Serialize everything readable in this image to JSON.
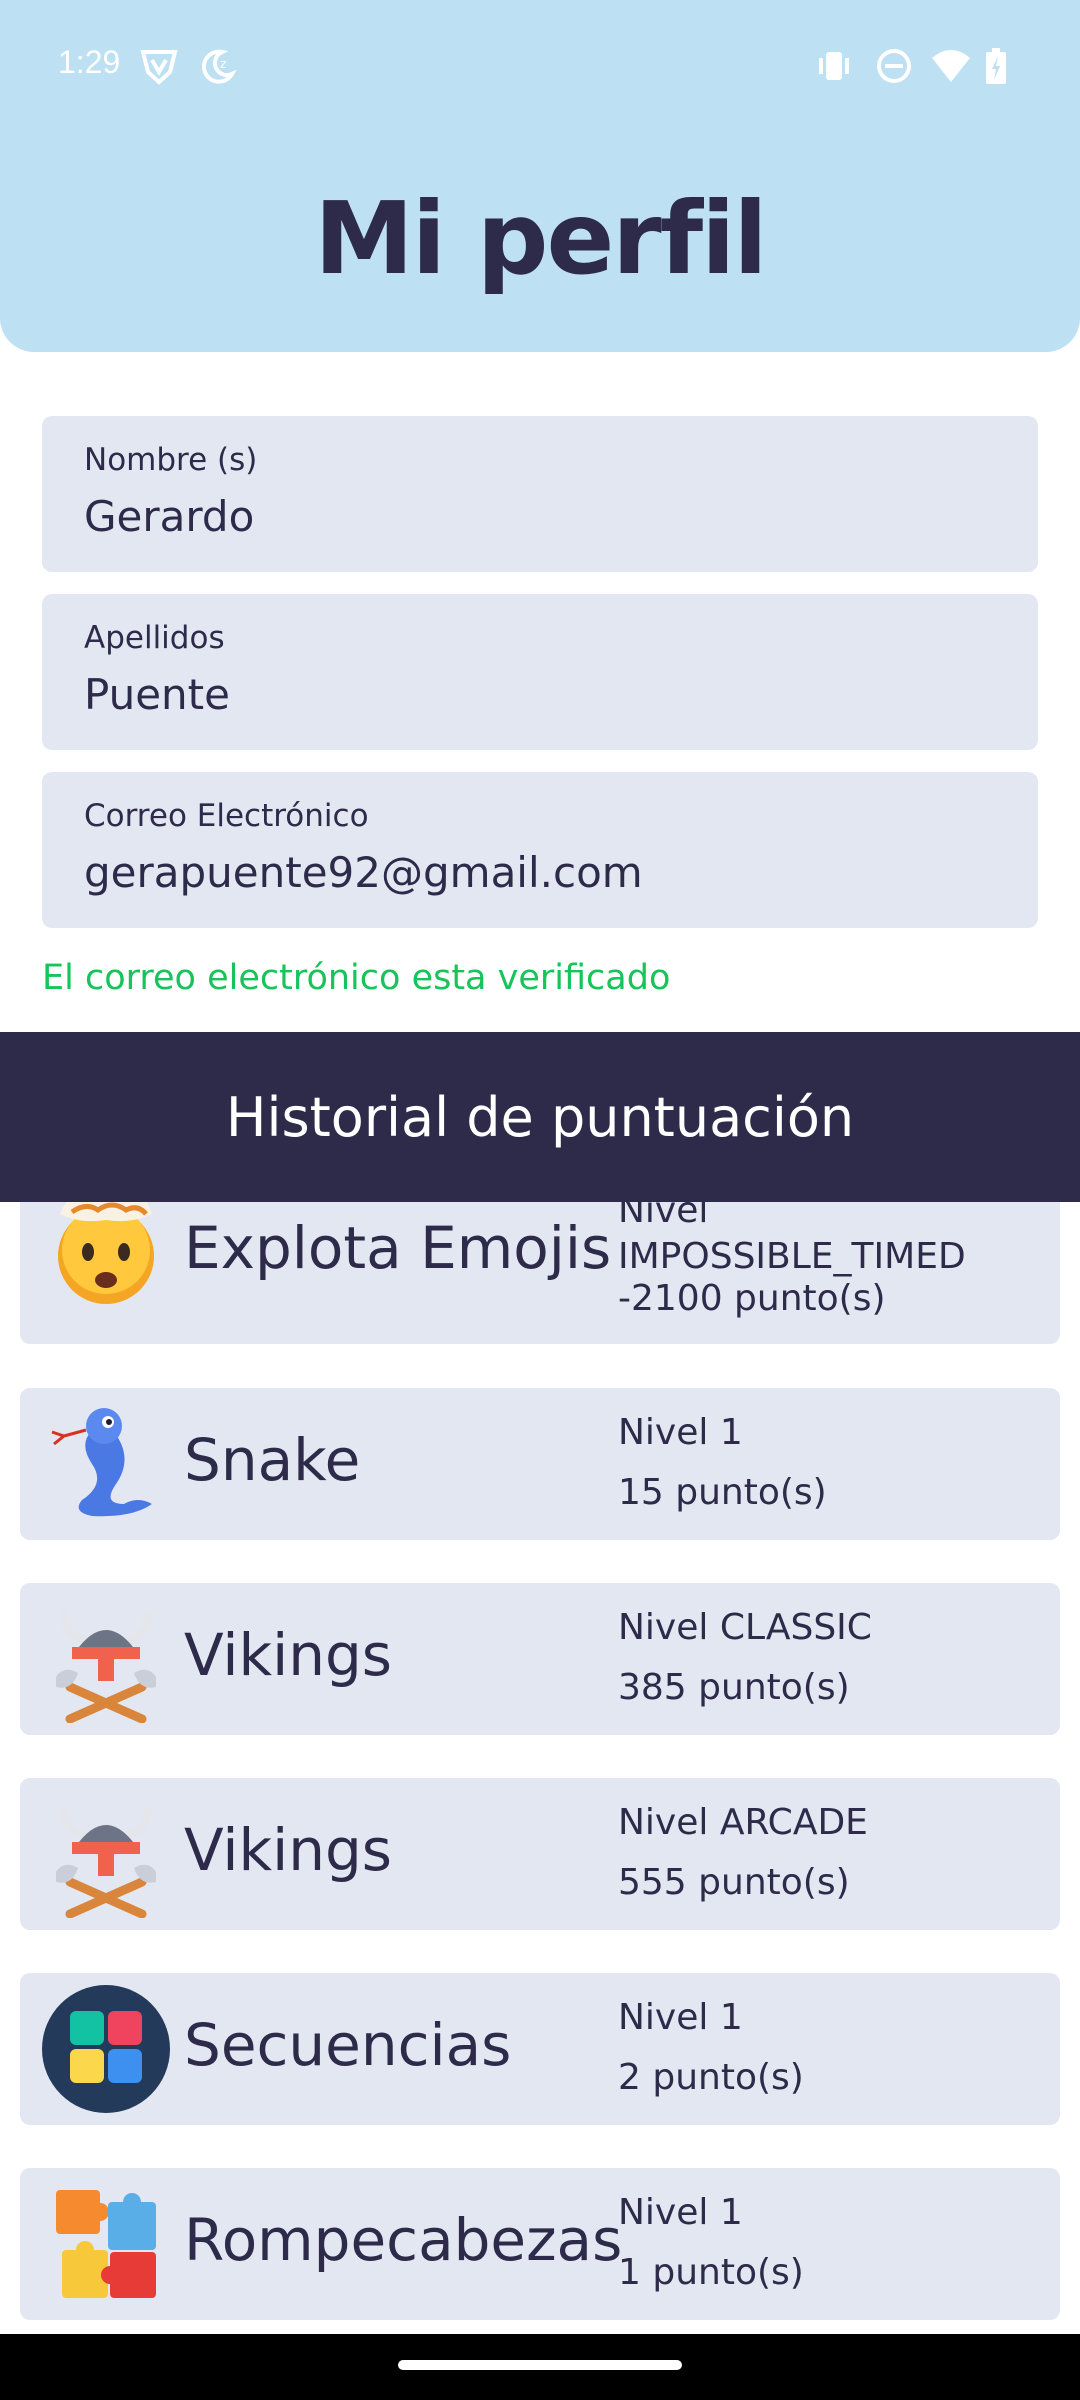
{
  "status_bar": {
    "time": "1:29",
    "icons": [
      "shield-v-icon",
      "moon-icon",
      "vibrate-icon",
      "do-not-disturb-icon",
      "wifi-icon",
      "battery-charging-icon"
    ]
  },
  "header": {
    "title": "Mi perfil",
    "background": "#bde0f3"
  },
  "form": {
    "first_name": {
      "label": "Nombre (s)",
      "value": "Gerardo"
    },
    "last_name": {
      "label": "Apellidos",
      "value": "Puente"
    },
    "email": {
      "label": "Correo Electrónico",
      "value": "gerapuente92@gmail.com"
    },
    "verified_text": "El correo electrónico esta verificado"
  },
  "history": {
    "title": "Historial de puntuación",
    "entries": [
      {
        "icon": "exploding-head-emoji-icon",
        "game": "Explota Emojis",
        "level": "Nivel IMPOSSIBLE_TIMED",
        "score": "-2100 punto(s)"
      },
      {
        "icon": "snake-icon",
        "game": "Snake",
        "level": "Nivel 1",
        "score": "15 punto(s)"
      },
      {
        "icon": "viking-helmet-axes-icon",
        "game": "Vikings",
        "level": "Nivel CLASSIC",
        "score": "385 punto(s)"
      },
      {
        "icon": "viking-helmet-axes-icon",
        "game": "Vikings",
        "level": "Nivel ARCADE",
        "score": "555 punto(s)"
      },
      {
        "icon": "color-squares-icon",
        "game": "Secuencias",
        "level": "Nivel 1",
        "score": "2 punto(s)"
      },
      {
        "icon": "puzzle-pieces-icon",
        "game": "Rompecabezas",
        "level": "Nivel 1",
        "score": "1 punto(s)"
      }
    ]
  },
  "colors": {
    "primary_dark": "#2e2a4a",
    "field_bg": "#e3e7f2",
    "verified_green": "#17c45a"
  }
}
